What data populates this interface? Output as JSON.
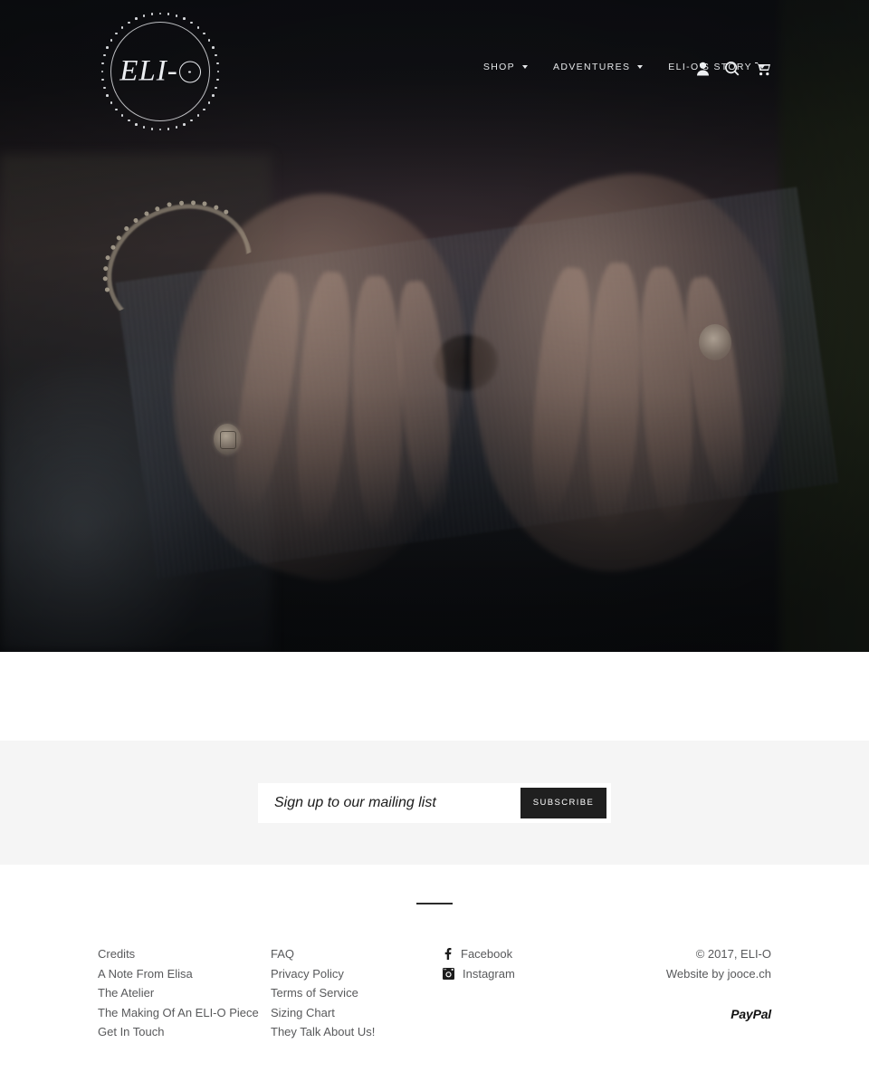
{
  "brand": {
    "logo_text": "ELI-",
    "logo_mark": "O",
    "logo_name": "ELI-O"
  },
  "nav": {
    "items": [
      {
        "label": "SHOP",
        "has_dropdown": true
      },
      {
        "label": "ADVENTURES",
        "has_dropdown": true
      },
      {
        "label": "ELI-O'S STORY",
        "has_dropdown": true
      }
    ],
    "icons": [
      {
        "name": "account-icon",
        "title": "Account"
      },
      {
        "name": "search-icon",
        "title": "Search"
      },
      {
        "name": "cart-icon",
        "title": "Cart"
      }
    ]
  },
  "hero": {
    "alt": "Hands resting on a weathered wooden plank wearing ELI-O rings and a bracelet"
  },
  "newsletter": {
    "placeholder": "Sign up to our mailing list",
    "value": "",
    "submit_label": "SUBSCRIBE"
  },
  "footer": {
    "links_column": [
      "Credits",
      "A Note From Elisa",
      "The Atelier",
      "The Making Of An ELI-O Piece",
      "Get In Touch"
    ],
    "help_column": [
      "FAQ",
      "Privacy Policy",
      "Terms of Service",
      "Sizing Chart",
      "They Talk About Us!"
    ],
    "social": [
      {
        "label": "Facebook",
        "icon": "facebook-icon"
      },
      {
        "label": "Instagram",
        "icon": "instagram-icon"
      }
    ],
    "copyright": "© 2017, ELI-O",
    "credit": "Website by jooce.ch",
    "payment": "PayPal"
  },
  "colors": {
    "accent_dark": "#1f1f1f",
    "band_grey": "#f5f5f5",
    "text_grey": "#58595b",
    "nav_text": "#e6e8ea"
  }
}
